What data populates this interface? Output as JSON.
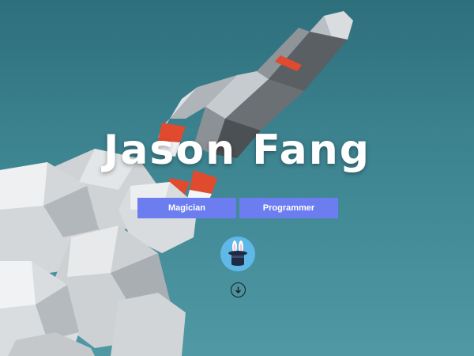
{
  "hero": {
    "name": "Jason Fang",
    "tags": [
      "Magician",
      "Programmer"
    ]
  },
  "icons": {
    "avatar": "magic-hat-rabbit-icon",
    "scroll": "arrow-down-circle-icon"
  },
  "colors": {
    "background_top": "#2e6f7c",
    "background_bottom": "#4f98a4",
    "tag_bg": "#6c7df0",
    "avatar_bg": "#5fb8e6",
    "rocket_stripe": "#e04a2e"
  }
}
